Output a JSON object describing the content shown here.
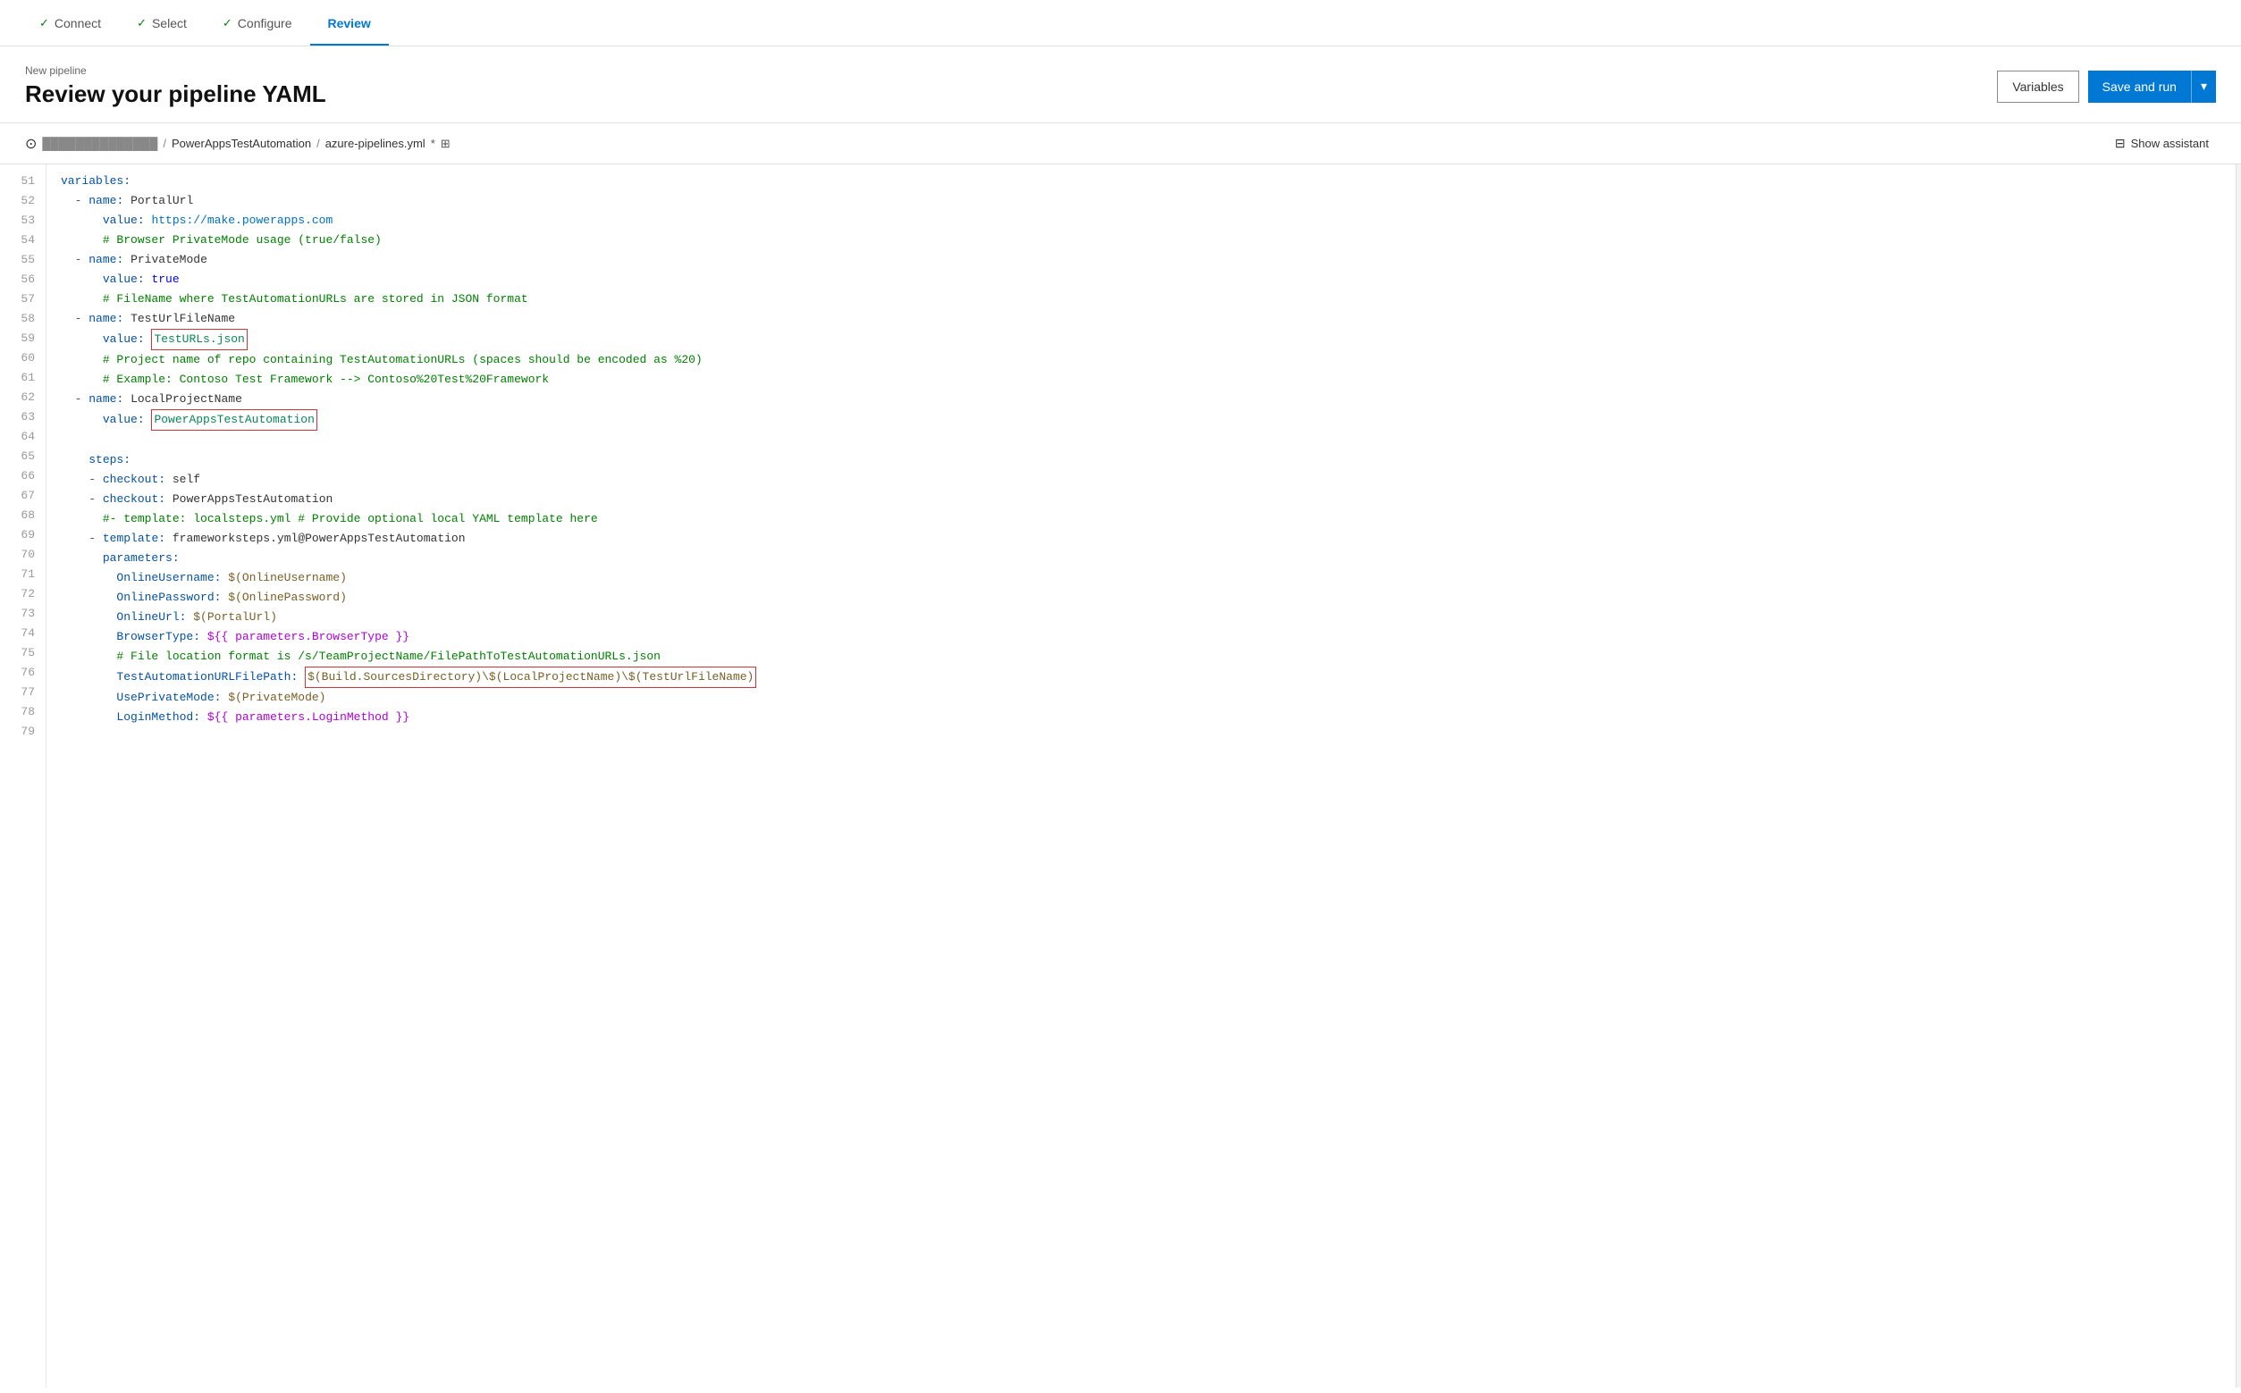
{
  "nav": {
    "steps": [
      {
        "id": "connect",
        "label": "Connect",
        "checked": true,
        "active": false
      },
      {
        "id": "select",
        "label": "Select",
        "checked": true,
        "active": false
      },
      {
        "id": "configure",
        "label": "Configure",
        "checked": true,
        "active": false
      },
      {
        "id": "review",
        "label": "Review",
        "checked": false,
        "active": true
      }
    ]
  },
  "header": {
    "subtitle": "New pipeline",
    "title": "Review your pipeline YAML",
    "variables_label": "Variables",
    "save_run_label": "Save and run"
  },
  "file_bar": {
    "repo_icon": "⊙",
    "repo_name": "██████████████",
    "separator1": "/",
    "repo_path": "PowerAppsTestAutomation",
    "separator2": "/",
    "file_name": "azure-pipelines.yml",
    "modified": "*",
    "show_assistant_label": "Show assistant"
  },
  "code": {
    "lines": [
      {
        "num": 51,
        "content": "variables:",
        "type": "key"
      },
      {
        "num": 52,
        "content": "  - name: PortalUrl",
        "type": "mixed"
      },
      {
        "num": 53,
        "content": "      value: https://make.powerapps.com",
        "type": "url"
      },
      {
        "num": 54,
        "content": "      # Browser PrivateMode usage (true/false)",
        "type": "comment"
      },
      {
        "num": 55,
        "content": "  - name: PrivateMode",
        "type": "mixed"
      },
      {
        "num": 56,
        "content": "      value: true",
        "type": "bool"
      },
      {
        "num": 57,
        "content": "      # FileName where TestAutomationURLs are stored in JSON format",
        "type": "comment"
      },
      {
        "num": 58,
        "content": "  - name: TestUrlFileName",
        "type": "mixed"
      },
      {
        "num": 59,
        "content": "      value: TestURLs.json",
        "type": "highlighted_red"
      },
      {
        "num": 60,
        "content": "      # Project name of repo containing TestAutomationURLs (spaces should be encoded as %20)",
        "type": "comment"
      },
      {
        "num": 61,
        "content": "      # Example: Contoso Test Framework --> Contoso%20Test%20Framework",
        "type": "comment"
      },
      {
        "num": 62,
        "content": "  - name: LocalProjectName",
        "type": "mixed"
      },
      {
        "num": 63,
        "content": "      value: PowerAppsTestAutomation",
        "type": "highlighted_red2"
      },
      {
        "num": 64,
        "content": "",
        "type": "empty"
      },
      {
        "num": 65,
        "content": "    steps:",
        "type": "key"
      },
      {
        "num": 66,
        "content": "    - checkout: self",
        "type": "mixed"
      },
      {
        "num": 67,
        "content": "    - checkout: PowerAppsTestAutomation",
        "type": "mixed"
      },
      {
        "num": 68,
        "content": "      #- template: localsteps.yml # Provide optional local YAML template here",
        "type": "comment"
      },
      {
        "num": 69,
        "content": "    - template: frameworksteps.yml@PowerAppsTestAutomation",
        "type": "mixed"
      },
      {
        "num": 70,
        "content": "      parameters:",
        "type": "key_indent"
      },
      {
        "num": 71,
        "content": "        OnlineUsername: $(OnlineUsername)",
        "type": "param"
      },
      {
        "num": 72,
        "content": "        OnlinePassword: $(OnlinePassword)",
        "type": "param"
      },
      {
        "num": 73,
        "content": "        OnlineUrl: $(PortalUrl)",
        "type": "param"
      },
      {
        "num": 74,
        "content": "        BrowserType: ${{ parameters.BrowserType }}",
        "type": "param_template"
      },
      {
        "num": 75,
        "content": "        # File location format is /s/TeamProjectName/FilePathToTestAutomationURLs.json",
        "type": "comment"
      },
      {
        "num": 76,
        "content": "        TestAutomationURLFilePath: $(Build.SourcesDirectory)\\$(LocalProjectName)\\$(TestUrlFileName)",
        "type": "highlighted_red3"
      },
      {
        "num": 77,
        "content": "        UsePrivateMode: $(PrivateMode)",
        "type": "param"
      },
      {
        "num": 78,
        "content": "        LoginMethod: ${{ parameters.LoginMethod }}",
        "type": "param_template"
      },
      {
        "num": 79,
        "content": "",
        "type": "empty"
      }
    ]
  },
  "colors": {
    "accent_blue": "#0078d4",
    "active_tab_line": "#0078d4",
    "red_box": "#d13438",
    "check_green": "#107c10"
  }
}
